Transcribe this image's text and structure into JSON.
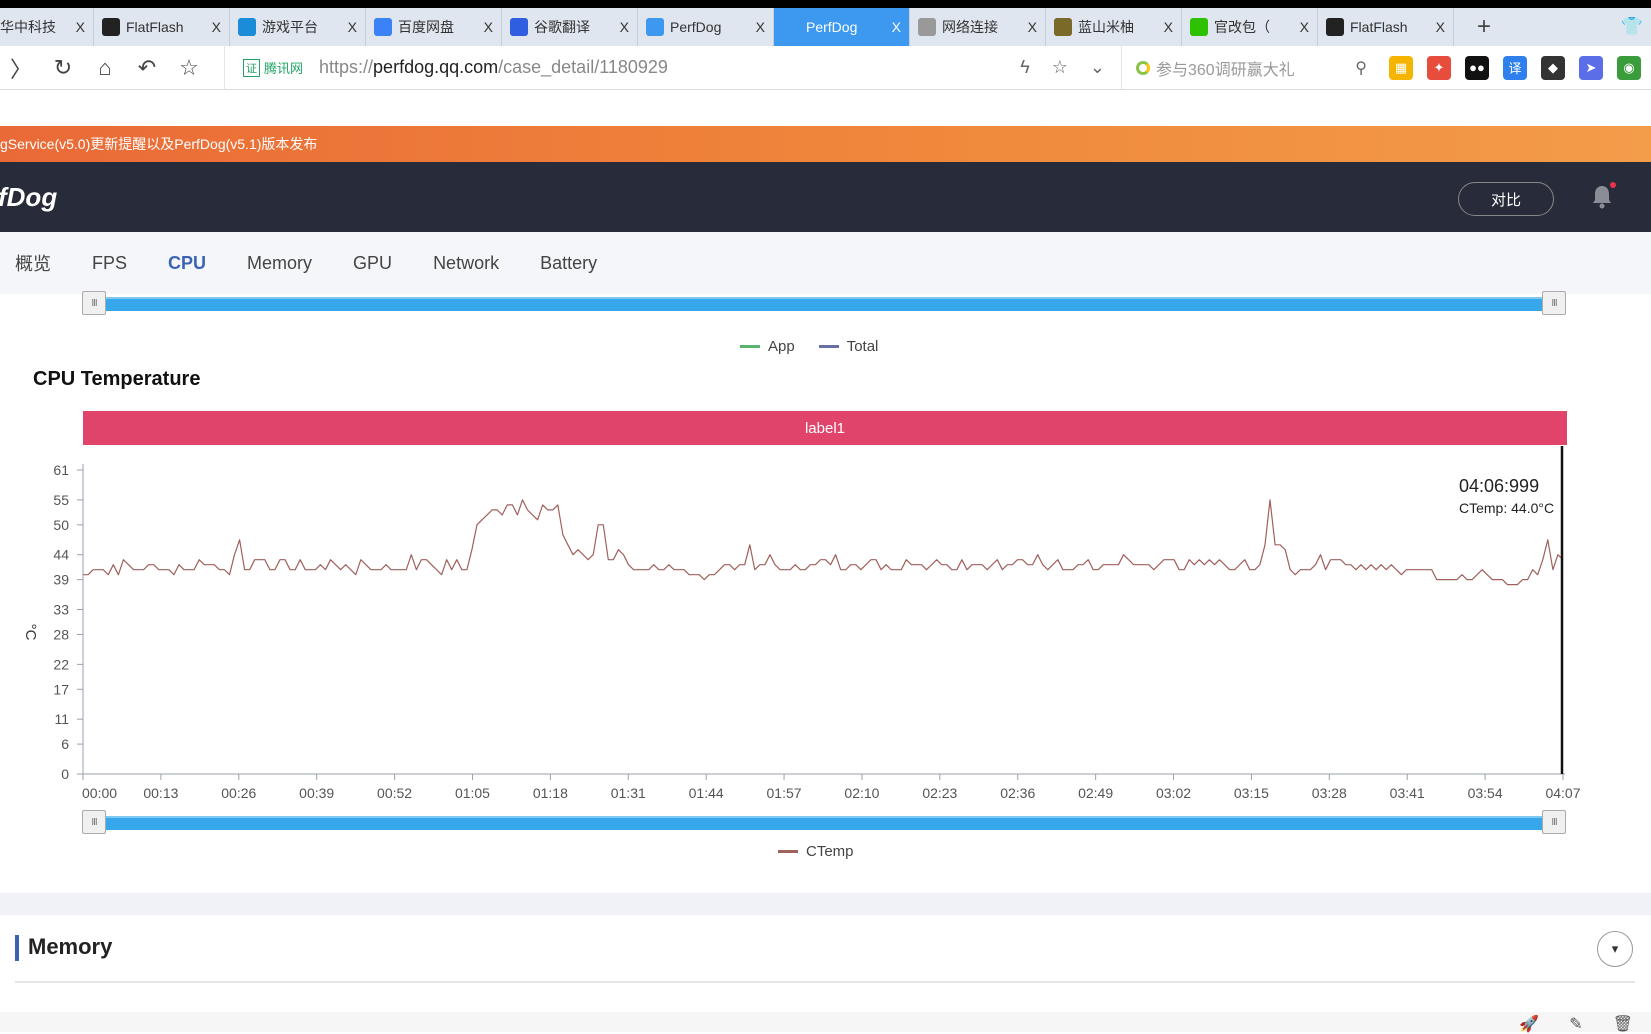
{
  "browser": {
    "tabs": [
      {
        "label": "华中科技",
        "icon": "hust-icon",
        "color": "#c0392b",
        "active": false
      },
      {
        "label": "FlatFlash",
        "icon": "flatflash-icon",
        "color": "#222222",
        "active": false
      },
      {
        "label": "游戏平台",
        "icon": "game-platform-icon",
        "color": "#1a8cd8",
        "active": false
      },
      {
        "label": "百度网盘",
        "icon": "baidu-netdisk-icon",
        "color": "#3b82f6",
        "active": false
      },
      {
        "label": "谷歌翻译",
        "icon": "baidu-paw-icon",
        "color": "#2f5ee0",
        "active": false
      },
      {
        "label": "PerfDog",
        "icon": "perfdog-icon",
        "color": "#3d98f0",
        "active": false
      },
      {
        "label": "PerfDog",
        "icon": "perfdog-icon",
        "color": "#3d98f0",
        "active": true
      },
      {
        "label": "网络连接",
        "icon": "document-icon",
        "color": "#999999",
        "active": false
      },
      {
        "label": "蓝山米柚",
        "icon": "turtle-icon",
        "color": "#7a6a2a",
        "active": false
      },
      {
        "label": "官改包（",
        "icon": "wechat-icon",
        "color": "#2dc100",
        "active": false
      },
      {
        "label": "FlatFlash",
        "icon": "flatflash-icon",
        "color": "#222222",
        "active": false
      }
    ],
    "close_glyph": "X",
    "new_tab_glyph": "+",
    "url_prefix": "https://",
    "url_domain": "perfdog.qq.com",
    "url_path": "/case_detail/1180929",
    "cert_badge": "证",
    "cert_label": "腾讯网",
    "search_placeholder": "参与360调研赢大礼",
    "nav": {
      "forward": "〉",
      "refresh": "↻",
      "home": "⌂",
      "undo": "↶",
      "bookmark": "☆"
    },
    "extensions": [
      {
        "name": "apps-ext",
        "glyph": "▦",
        "color": "#f4b400"
      },
      {
        "name": "game-ext",
        "glyph": "✦",
        "color": "#e74c3c"
      },
      {
        "name": "media-ext",
        "glyph": "●●",
        "color": "#111111"
      },
      {
        "name": "translate-ext",
        "glyph": "译",
        "color": "#2f80ed"
      },
      {
        "name": "evernote-ext",
        "glyph": "◆",
        "color": "#333333"
      },
      {
        "name": "swift-ext",
        "glyph": "➤",
        "color": "#5b6ee8"
      },
      {
        "name": "globe-ext",
        "glyph": "◉",
        "color": "#3a9c3a"
      }
    ]
  },
  "notice": {
    "text": "gService(v5.0)更新提醒以及PerfDog(v5.1)版本发布"
  },
  "header": {
    "logo": "fDog",
    "compare_label": "对比"
  },
  "subnav": {
    "items": [
      {
        "label": "概览",
        "active": false
      },
      {
        "label": "FPS",
        "active": false
      },
      {
        "label": "CPU",
        "active": true
      },
      {
        "label": "Memory",
        "active": false
      },
      {
        "label": "GPU",
        "active": false
      },
      {
        "label": "Network",
        "active": false
      },
      {
        "label": "Battery",
        "active": false
      }
    ]
  },
  "cpu_usage_legend": [
    {
      "label": "App",
      "color": "#5ab46e"
    },
    {
      "label": "Total",
      "color": "#6870a8"
    }
  ],
  "slider_glyph": "III",
  "cpu_temperature": {
    "title": "CPU Temperature",
    "label_band": "label1",
    "label_band_color": "#e0446a",
    "tooltip": {
      "time": "04:06:999",
      "value": "CTemp: 44.0°C"
    }
  },
  "chart_data": {
    "type": "line",
    "title": "CPU Temperature",
    "xlabel": "",
    "ylabel": "°C",
    "y_ticks": [
      0,
      6,
      11,
      17,
      22,
      28,
      33,
      39,
      44,
      50,
      55,
      61
    ],
    "ylim": [
      0,
      61
    ],
    "x_ticks": [
      "00:00",
      "00:13",
      "00:26",
      "00:39",
      "00:52",
      "01:05",
      "01:18",
      "01:31",
      "01:44",
      "01:57",
      "02:10",
      "02:23",
      "02:36",
      "02:49",
      "03:02",
      "03:15",
      "03:28",
      "03:41",
      "03:54",
      "04:07"
    ],
    "xlim_seconds": [
      0,
      247
    ],
    "grid": false,
    "legend": {
      "position": "bottom-center",
      "entries": [
        "CTemp"
      ]
    },
    "series": [
      {
        "name": "CTemp",
        "color": "#a0605c",
        "x_step_seconds": 1.3,
        "values": [
          40,
          40,
          41,
          41,
          41,
          40,
          42,
          40,
          43,
          42,
          41,
          41,
          41,
          42,
          42,
          41,
          41,
          41,
          40,
          42,
          41,
          41,
          41,
          43,
          42,
          42,
          42,
          41,
          41,
          40,
          44,
          47,
          41,
          41,
          43,
          43,
          43,
          41,
          41,
          43,
          43,
          41,
          41,
          43,
          41,
          41,
          41,
          42,
          41,
          43,
          42,
          41,
          42,
          41,
          40,
          43,
          42,
          41,
          41,
          41,
          42,
          41,
          41,
          41,
          41,
          44,
          41,
          43,
          43,
          42,
          41,
          40,
          43,
          41,
          43,
          41,
          41,
          45,
          50,
          51,
          52,
          53,
          53,
          52,
          54,
          54,
          52,
          55,
          53,
          52,
          51,
          54,
          53,
          53,
          54,
          48,
          46,
          44,
          45,
          44,
          43,
          44,
          50,
          50,
          43,
          43,
          45,
          44,
          42,
          41,
          41,
          41,
          41,
          42,
          41,
          41,
          42,
          41,
          41,
          41,
          40,
          40,
          40,
          39,
          40,
          40,
          41,
          42,
          42,
          41,
          42,
          42,
          46,
          41,
          42,
          42,
          44,
          42,
          41,
          41,
          41,
          42,
          41,
          41,
          42,
          42,
          43,
          43,
          42,
          44,
          41,
          41,
          42,
          42,
          41,
          42,
          43,
          43,
          41,
          42,
          41,
          41,
          41,
          43,
          42,
          42,
          42,
          41,
          42,
          43,
          42,
          42,
          41,
          41,
          43,
          41,
          42,
          42,
          42,
          41,
          42,
          43,
          41,
          42,
          42,
          43,
          43,
          42,
          42,
          44,
          42,
          41,
          42,
          43,
          41,
          41,
          41,
          42,
          42,
          43,
          41,
          41,
          42,
          42,
          42,
          42,
          44,
          43,
          42,
          42,
          42,
          42,
          41,
          42,
          43,
          43,
          43,
          41,
          41,
          43,
          42,
          43,
          42,
          43,
          42,
          43,
          42,
          41,
          41,
          42,
          43,
          41,
          41,
          42,
          46,
          55,
          46,
          46,
          45,
          41,
          40,
          41,
          41,
          41,
          42,
          44,
          41,
          43,
          43,
          43,
          42,
          42,
          41,
          42,
          41,
          42,
          41,
          42,
          41,
          42,
          41,
          40,
          41,
          41,
          41,
          41,
          41,
          41,
          39,
          39,
          39,
          39,
          39,
          40,
          39,
          39,
          40,
          41,
          40,
          39,
          39,
          39,
          38,
          38,
          38,
          39,
          39,
          41,
          40,
          43,
          47,
          41,
          44,
          43
        ]
      }
    ],
    "cursor_at": "04:07"
  },
  "memory_section": {
    "title": "Memory",
    "toggle_glyph": "▾"
  },
  "footer_icons": [
    "rocket-icon",
    "edit-icon",
    "trash-icon"
  ]
}
